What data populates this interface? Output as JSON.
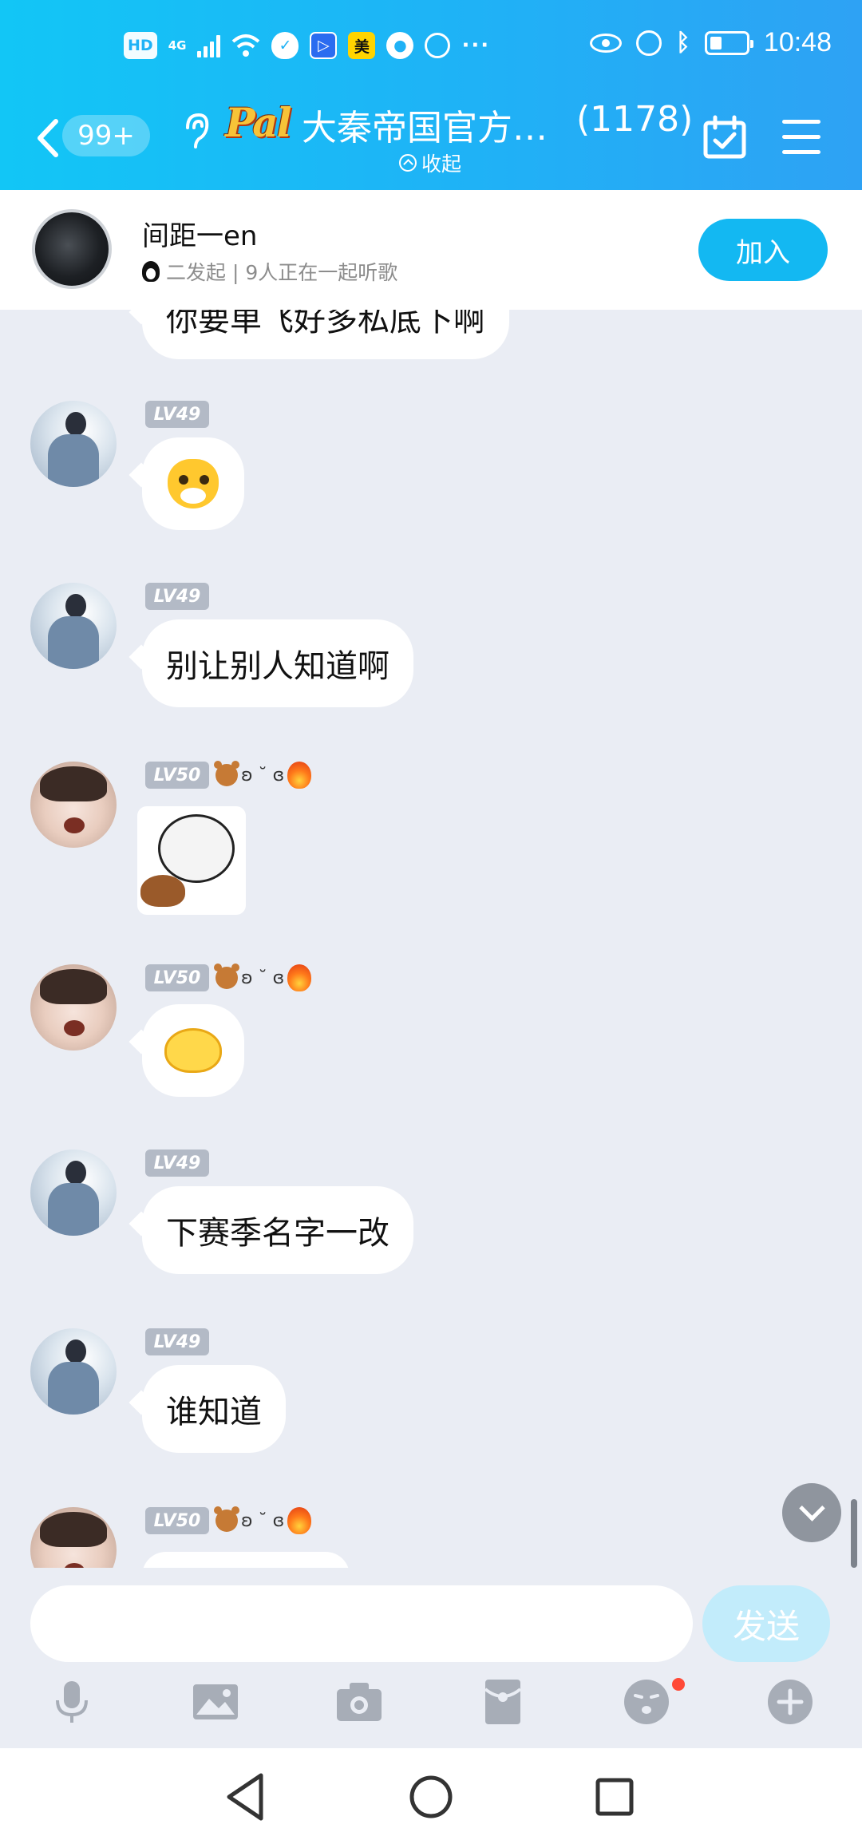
{
  "status_bar": {
    "hd": "HD",
    "network": "4G",
    "app_badge_mei": "美",
    "more": "···",
    "time": "10:48"
  },
  "header": {
    "unread_count": "99+",
    "group_logo_text": "Pal",
    "group_name": "大秦帝国官方…",
    "member_count": "(1178)",
    "collapse_label": "收起"
  },
  "music": {
    "title": "间距一en",
    "subtitle": "二发起 | 9人正在一起听歌",
    "join_label": "加入"
  },
  "messages": [
    {
      "type": "text",
      "text": "你要单飞好多私底下啊"
    },
    {
      "level": "LV49",
      "type": "sticker",
      "sticker": "cat-face-sticker"
    },
    {
      "level": "LV49",
      "type": "text",
      "text": "别让别人知道啊"
    },
    {
      "level": "LV50",
      "deco": "ʚ ˘ ɞ",
      "type": "sticker",
      "sticker": "panda-guitar-sticker"
    },
    {
      "level": "LV50",
      "deco": "ʚ ˘ ɞ",
      "type": "sticker",
      "sticker": "yellow-chick-sticker"
    },
    {
      "level": "LV49",
      "type": "text",
      "text": "下赛季名字一改"
    },
    {
      "level": "LV49",
      "type": "text",
      "text": "谁知道"
    },
    {
      "level": "LV50",
      "deco": "ʚ ˘ ɞ",
      "type": "partial"
    }
  ],
  "composer": {
    "input_value": "",
    "send_label": "发送"
  },
  "toolbar_icons": [
    "microphone-icon",
    "picture-icon",
    "camera-icon",
    "red-packet-icon",
    "emoji-icon",
    "plus-icon"
  ],
  "colors": {
    "header_start": "#12c6f6",
    "header_end": "#2ea2f4",
    "join_button": "#13b8f2",
    "chat_background": "#eaedf4",
    "send_button_disabled": "#c2ecfb",
    "level_badge": "#b3bac6"
  }
}
